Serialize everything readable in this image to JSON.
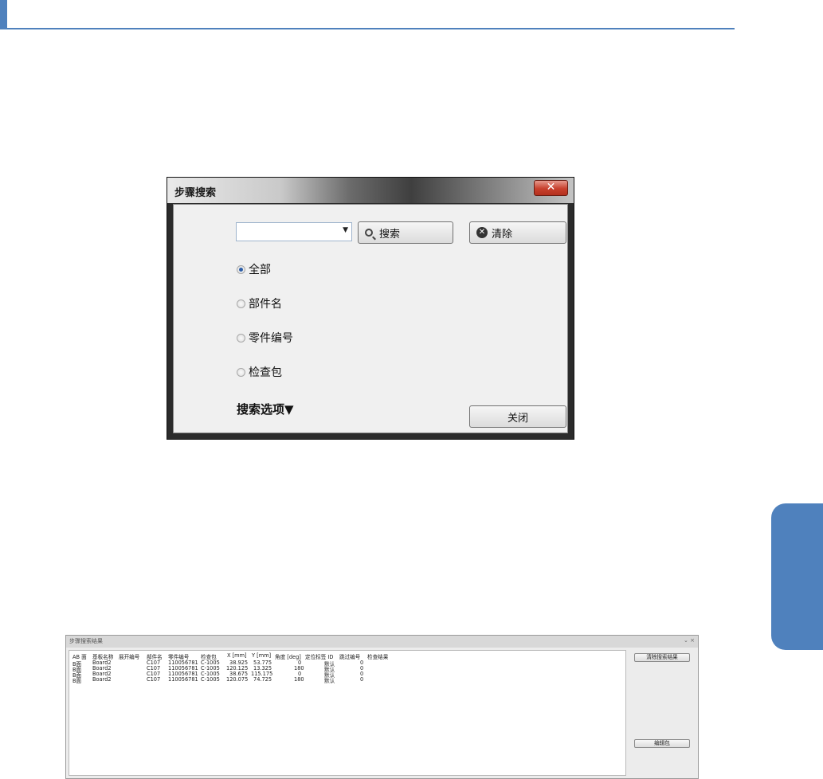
{
  "search_dialog": {
    "title": "步骤搜索",
    "close_glyph": "✕",
    "search_value": "",
    "search_button": "搜索",
    "clear_button": "清除",
    "radio_options": [
      {
        "label": "全部",
        "selected": true
      },
      {
        "label": "部件名",
        "selected": false
      },
      {
        "label": "零件编号",
        "selected": false
      },
      {
        "label": "检查包",
        "selected": false
      }
    ],
    "options_toggle": "搜索选项▼",
    "close_button": "关闭"
  },
  "results_window": {
    "title": "步骤搜索结果",
    "controls": "⌄ ×",
    "columns": [
      "AB 面",
      "基板名称",
      "展开编号",
      "部件名",
      "零件编号",
      "检查包",
      "X [mm]",
      "Y [mm]",
      "角度 [deg]",
      "定位标签 ID",
      "跳过编号",
      "检查结果"
    ],
    "rows": [
      [
        "B面",
        "Board2",
        "",
        "C107",
        "110056781",
        "C-1005",
        "38.925",
        "53.775",
        "0",
        "默认",
        "0",
        ""
      ],
      [
        "B面",
        "Board2",
        "",
        "C107",
        "110056781",
        "C-1005",
        "120.125",
        "13.325",
        "180",
        "默认",
        "0",
        ""
      ],
      [
        "B面",
        "Board2",
        "",
        "C107",
        "110056781",
        "C-1005",
        "38.675",
        "115.175",
        "0",
        "默认",
        "0",
        ""
      ],
      [
        "B面",
        "Board2",
        "",
        "C107",
        "110056781",
        "C-1005",
        "120.075",
        "74.725",
        "180",
        "默认",
        "0",
        ""
      ]
    ],
    "clear_results_button": "清除搜索结果",
    "edit_package_button": "编辑包"
  }
}
